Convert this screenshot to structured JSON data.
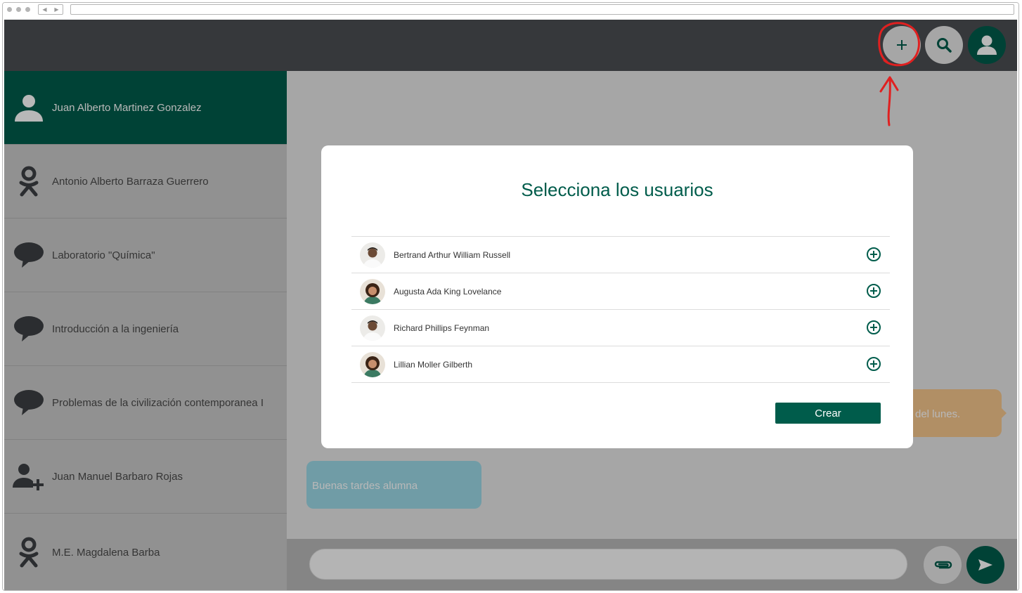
{
  "header": {
    "actions": [
      {
        "name": "add-chat-button",
        "icon": "plus-icon"
      },
      {
        "name": "search-button",
        "icon": "search-icon"
      },
      {
        "name": "profile-button",
        "icon": "user-icon"
      }
    ]
  },
  "sidebar": {
    "items": [
      {
        "label": "Juan Alberto Martinez Gonzalez",
        "icon": "user-icon",
        "active": true
      },
      {
        "label": "Antonio Alberto Barraza Guerrero",
        "icon": "person-circle-icon"
      },
      {
        "label": "Laboratorio \"Química\"",
        "icon": "speech-bubble-icon"
      },
      {
        "label": "Introducción a la ingeniería",
        "icon": "speech-bubble-icon"
      },
      {
        "label": "Problemas de la civilización contemporanea I",
        "icon": "speech-bubble-icon"
      },
      {
        "label": "Juan Manuel Barbaro Rojas",
        "icon": "add-user-icon"
      },
      {
        "label": "M.E. Magdalena Barba",
        "icon": "person-circle-icon"
      }
    ]
  },
  "chat": {
    "messages": [
      {
        "text": "del lunes.",
        "direction": "outgoing"
      },
      {
        "text": "Buenas tardes alumna",
        "direction": "incoming"
      }
    ],
    "input_placeholder": ""
  },
  "modal": {
    "title": "Selecciona los usuarios",
    "users": [
      {
        "name": "Bertrand Arthur William Russell",
        "avatar": "man-avatar"
      },
      {
        "name": "Augusta Ada King Lovelance",
        "avatar": "woman-avatar"
      },
      {
        "name": "Richard Phillips Feynman",
        "avatar": "man-avatar"
      },
      {
        "name": "Lillian Moller Gilberth",
        "avatar": "woman-avatar"
      }
    ],
    "create_label": "Crear"
  },
  "colors": {
    "primary": "#005c4b",
    "topbar": "#4b4e52",
    "annotation": "#e02020",
    "incoming_bubble": "#9bd8e6",
    "outgoing_bubble": "#f5c68d"
  }
}
